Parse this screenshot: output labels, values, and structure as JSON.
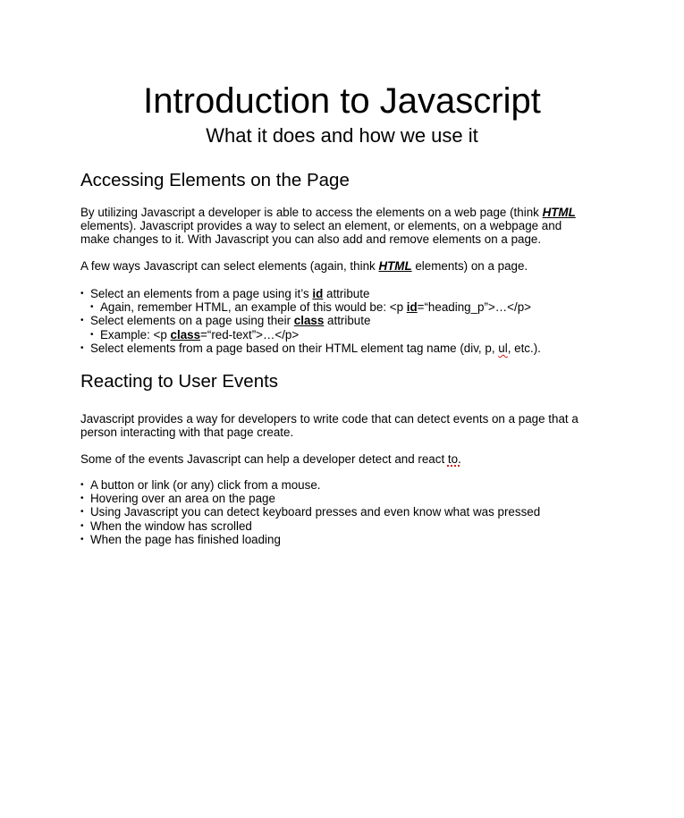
{
  "title": "Introduction to Javascript",
  "subtitle": "What it does and how we use it",
  "section1": {
    "heading": "Accessing Elements on the Page",
    "para1_part1": "By utilizing Javascript a developer is able to access the elements on a web page (think ",
    "para1_html": "HTML",
    "para1_line2_part1": "elements).  Javascript provides a way to select an element, or elements, on a webpage and",
    "para1_line3": "make changes to it.  With Javascript you can also add and remove elements on a page.",
    "para2_part1": "A few ways Javascript can select elements (again, think ",
    "para2_html": "HTML",
    "para2_part2": " elements) on a page.",
    "bullets": {
      "b1_part1": "Select an elements from a page using it’s ",
      "b1_id": "id",
      "b1_part2": " attribute",
      "b1_sub_part1": "Again, remember HTML, an example of this would be: <p ",
      "b1_sub_id": "id",
      "b1_sub_part2": "=“heading_p”>…</p>",
      "b2_part1": "Select elements on a page using their ",
      "b2_class": "class",
      "b2_part2": " attribute",
      "b2_sub_part1": "Example: <p ",
      "b2_sub_class": "class",
      "b2_sub_part2": "=“red-text”>…</p>",
      "b3_part1": "Select elements from a page based on their HTML element tag name (div, p, ",
      "b3_ul": "ul",
      "b3_part2": ", etc.)."
    }
  },
  "section2": {
    "heading": "Reacting to User Events",
    "para1_line1": "Javascript provides a way for developers to write code that can detect events on a page that a",
    "para1_line2": "person interacting with that page create.",
    "para2_part1": "Some of the events Javascript can help a developer detect and react ",
    "para2_to": "to.",
    "bullets": [
      "A button or link (or any) click from a mouse.",
      "Hovering over an area on the page",
      "Using Javascript you can detect keyboard presses and even know what was pressed",
      "When the window has scrolled",
      "When the page has finished loading"
    ]
  },
  "bullet_glyph": "•"
}
